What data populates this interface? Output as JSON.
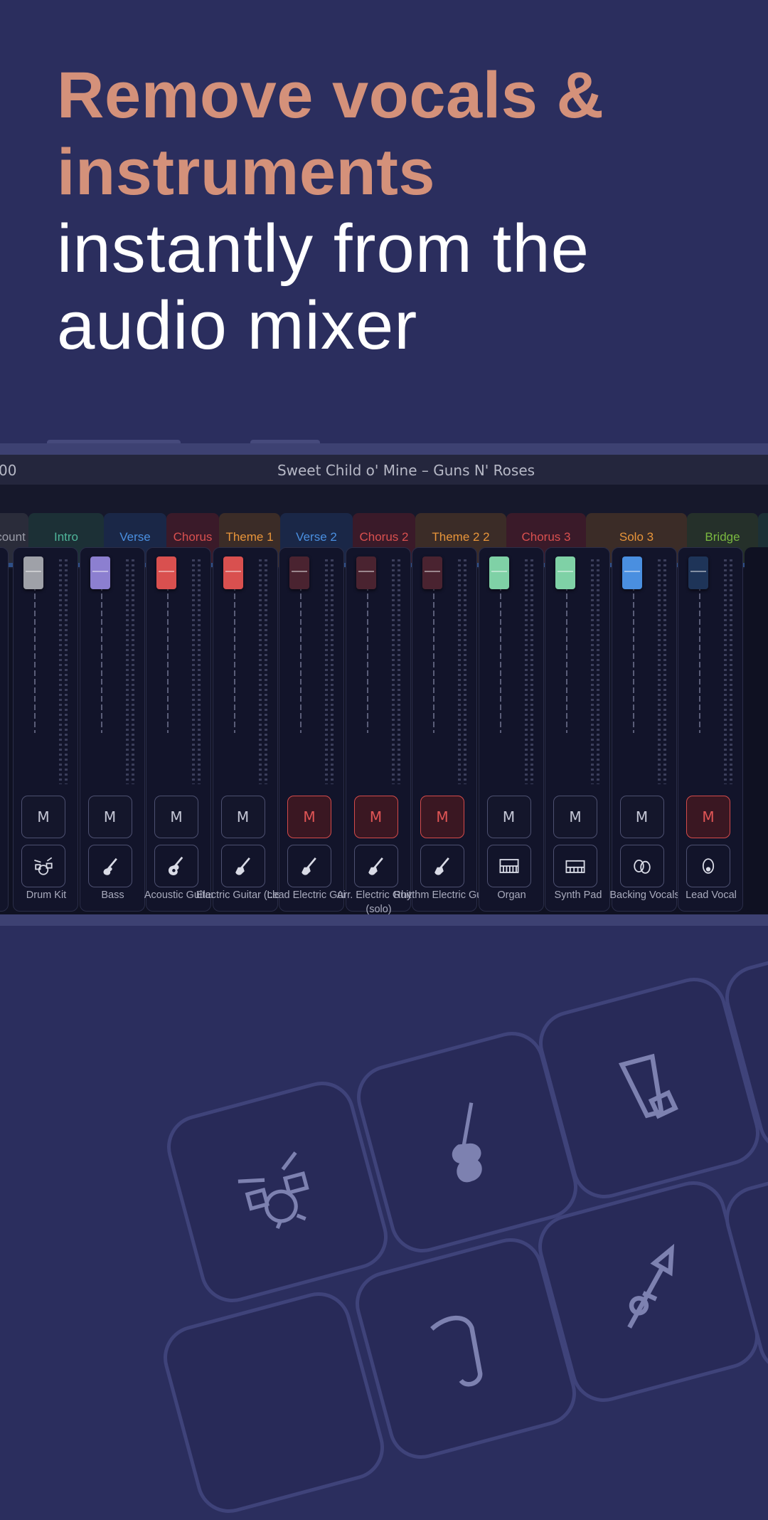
{
  "headline": {
    "accent_line1": "Remove vocals &",
    "accent_line2": "instruments",
    "plain_line1": "instantly from the",
    "plain_line2": "audio mixer"
  },
  "mixer": {
    "song_title": "Sweet Child o' Mine – Guns N' Roses",
    "partial_left_text": "00",
    "sections": [
      {
        "label": "count",
        "color": "#9a9ca8"
      },
      {
        "label": "Intro",
        "color": "#4fb59a"
      },
      {
        "label": "Verse",
        "color": "#4a8fe0"
      },
      {
        "label": "Chorus",
        "color": "#d9504f"
      },
      {
        "label": "Theme 1",
        "color": "#e8953a"
      },
      {
        "label": "Verse 2",
        "color": "#4a8fe0"
      },
      {
        "label": "Chorus 2",
        "color": "#d9504f"
      },
      {
        "label": "Theme 2 2",
        "color": "#e8953a"
      },
      {
        "label": "Chorus 3",
        "color": "#d9504f"
      },
      {
        "label": "Solo 3",
        "color": "#e8953a"
      },
      {
        "label": "Bridge",
        "color": "#7ab840"
      }
    ],
    "mute_label": "M",
    "channels": [
      {
        "name": "Drum Kit",
        "icon": "drum-kit-icon",
        "knob_color": "#9fa1a8",
        "muted": false
      },
      {
        "name": "Bass",
        "icon": "bass-guitar-icon",
        "knob_color": "#8c7fd0",
        "muted": false
      },
      {
        "name": "Acoustic Guitar",
        "icon": "acoustic-guitar-icon",
        "knob_color": "#d9504f",
        "muted": false
      },
      {
        "name": "Electric Guitar (clean)",
        "icon": "electric-guitar-icon",
        "knob_color": "#d9504f",
        "muted": false
      },
      {
        "name": "Lead Electric Guitar",
        "icon": "electric-guitar-icon",
        "knob_color": "#4a2330",
        "muted": true
      },
      {
        "name": "Arr. Electric Guitar (solo)",
        "icon": "electric-guitar-icon",
        "knob_color": "#4a2330",
        "muted": true
      },
      {
        "name": "Rhythm Electric Guitar",
        "icon": "electric-guitar-icon",
        "knob_color": "#4a2330",
        "muted": true
      },
      {
        "name": "Organ",
        "icon": "organ-icon",
        "knob_color": "#7fd1a6",
        "muted": false
      },
      {
        "name": "Synth Pad",
        "icon": "synth-icon",
        "knob_color": "#7fd1a6",
        "muted": false
      },
      {
        "name": "Backing Vocals",
        "icon": "backing-vocals-icon",
        "knob_color": "#4a8fe0",
        "muted": false
      },
      {
        "name": "Lead Vocal",
        "icon": "lead-vocal-icon",
        "knob_color": "#1e3458",
        "muted": true
      }
    ]
  },
  "tiles": [
    "drum-kit-icon",
    "cello-icon",
    "conga-icon",
    "trumpet-icon",
    "saxophone-icon"
  ]
}
